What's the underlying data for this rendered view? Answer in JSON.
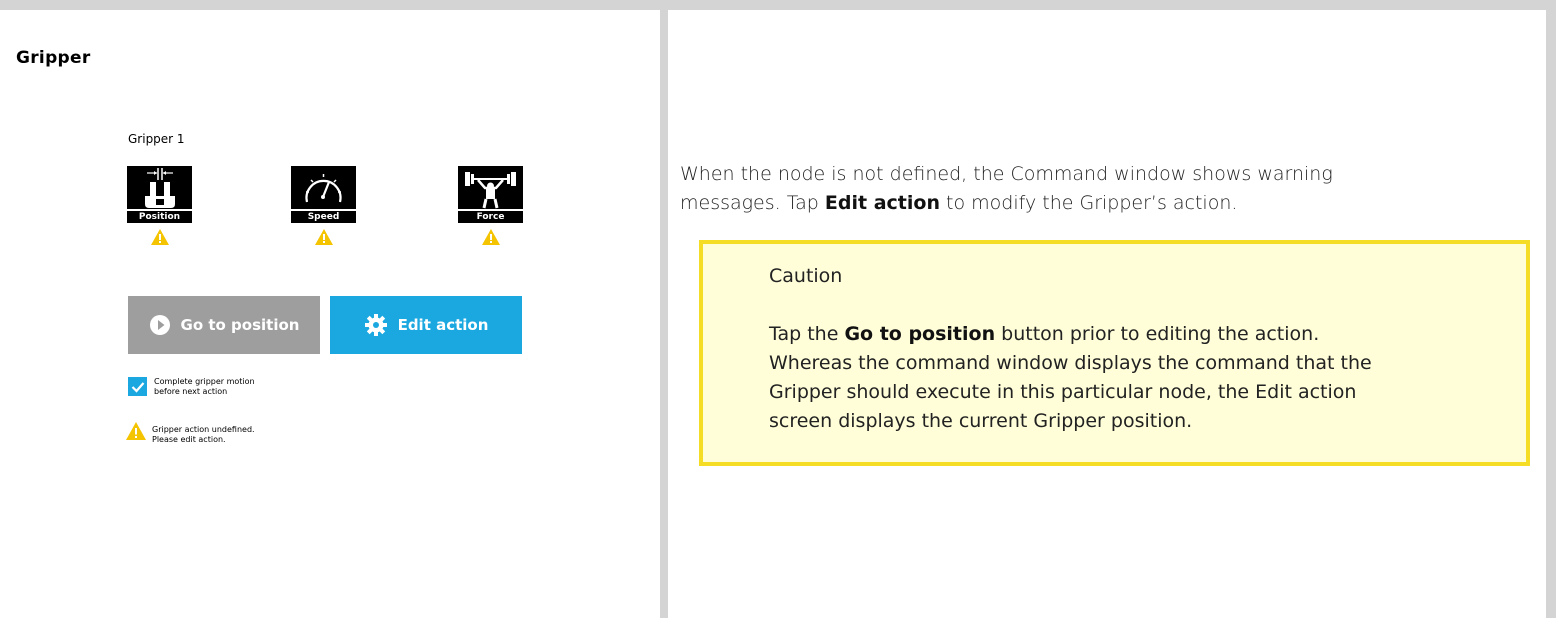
{
  "left_panel": {
    "title": "Gripper",
    "gripper_name": "Gripper 1",
    "params": [
      {
        "label": "Position",
        "icon": "gripper-position-icon",
        "warning": true
      },
      {
        "label": "Speed",
        "icon": "speedometer-icon",
        "warning": true
      },
      {
        "label": "Force",
        "icon": "weightlifter-icon",
        "warning": true
      }
    ],
    "buttons": {
      "go_to_position": "Go to position",
      "edit_action": "Edit action"
    },
    "checkbox": {
      "checked": true,
      "line1": "Complete gripper motion",
      "line2": "before next action"
    },
    "warning": {
      "line1": "Gripper action undefined.",
      "line2": "Please edit action."
    }
  },
  "right_panel": {
    "description": {
      "line1": "When the node is not defined, the Command window shows warning",
      "line2_pre": "messages. Tap ",
      "line2_bold": "Edit action",
      "line2_post": " to modify the Gripper’s action."
    },
    "caution": {
      "title": "Caution",
      "line1_pre": "Tap the ",
      "line1_bold": "Go to position",
      "line1_post": " button prior to editing the action.",
      "line2": "Whereas the command window displays the command that the",
      "line3": "Gripper should execute in this particular node, the Edit action",
      "line4": "screen displays the current Gripper position."
    }
  },
  "colors": {
    "accent_blue": "#1ba8e0",
    "button_gray": "#9e9e9e",
    "warning_yellow": "#f5c400",
    "caution_bg": "#fffed9",
    "caution_border": "#f5dd26",
    "frame_gray": "#d4d4d4"
  }
}
